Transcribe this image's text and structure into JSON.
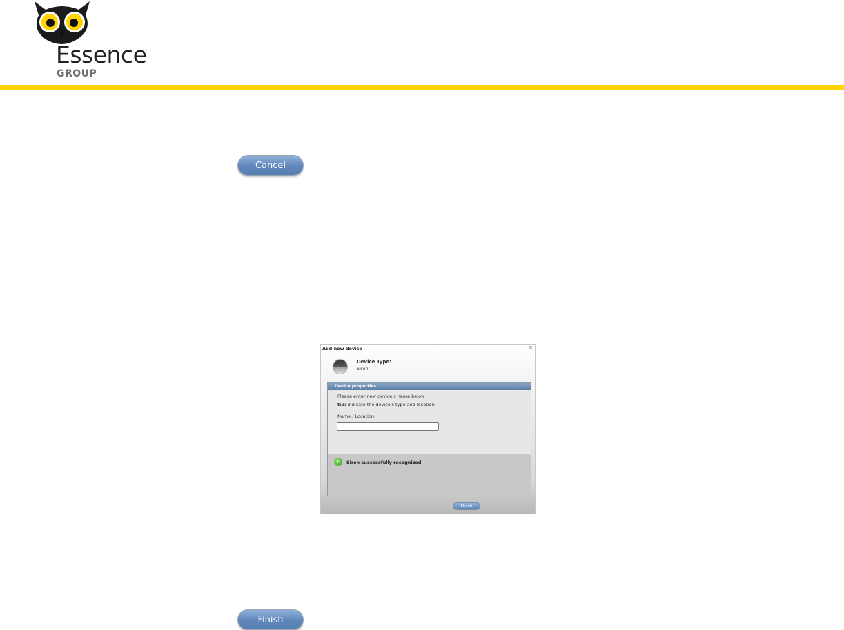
{
  "brand": {
    "name": "Essence",
    "group": "GROUP"
  },
  "buttons": {
    "cancel": "Cancel",
    "finish": "Finish"
  },
  "dialog": {
    "title": "Add new device",
    "close": "⊠",
    "device_type_label": "Device Type:",
    "device_type_value": "Siren",
    "panel_title": "Device properties",
    "instruction": "Please enter new device's name below",
    "tip_label": "tip:",
    "tip_text": " indicate the device's type and location:",
    "name_label": "Name / Location:",
    "name_value": "",
    "status": "Siren successfully recognized",
    "finish": "Finish"
  },
  "colors": {
    "accent_yellow": "#ffd400",
    "button_blue": "#5f86ba"
  }
}
